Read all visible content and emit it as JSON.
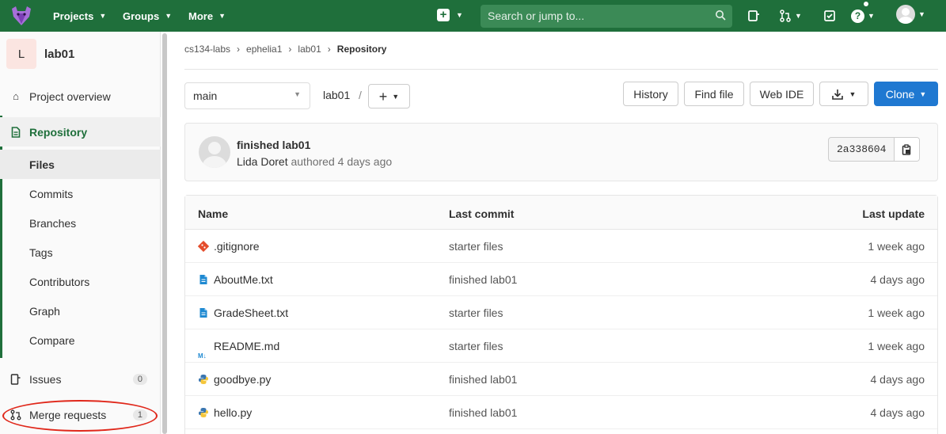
{
  "topnav": {
    "projects": "Projects",
    "groups": "Groups",
    "more": "More",
    "search_placeholder": "Search or jump to..."
  },
  "sidebar": {
    "project_initial": "L",
    "project_name": "lab01",
    "project_overview": "Project overview",
    "repository": "Repository",
    "sub_items": [
      "Files",
      "Commits",
      "Branches",
      "Tags",
      "Contributors",
      "Graph",
      "Compare"
    ],
    "issues": "Issues",
    "issues_count": "0",
    "merge_requests": "Merge requests",
    "merge_requests_count": "1"
  },
  "breadcrumb": {
    "items": [
      "cs134-labs",
      "ephelia1",
      "lab01"
    ],
    "current": "Repository"
  },
  "toolbar": {
    "branch": "main",
    "path": "lab01",
    "history": "History",
    "find_file": "Find file",
    "web_ide": "Web IDE",
    "clone": "Clone"
  },
  "commit": {
    "title": "finished lab01",
    "author": "Lida Doret",
    "meta": "authored 4 days ago",
    "sha": "2a338604"
  },
  "files": {
    "headers": {
      "name": "Name",
      "last_commit": "Last commit",
      "last_update": "Last update"
    },
    "rows": [
      {
        "name": ".gitignore",
        "commit": "starter files",
        "update": "1 week ago",
        "icon": "git-icon"
      },
      {
        "name": "AboutMe.txt",
        "commit": "finished lab01",
        "update": "4 days ago",
        "icon": "text-file-icon"
      },
      {
        "name": "GradeSheet.txt",
        "commit": "starter files",
        "update": "1 week ago",
        "icon": "text-file-icon"
      },
      {
        "name": "README.md",
        "commit": "starter files",
        "update": "1 week ago",
        "icon": "markdown-icon"
      },
      {
        "name": "goodbye.py",
        "commit": "finished lab01",
        "update": "4 days ago",
        "icon": "python-icon"
      },
      {
        "name": "hello.py",
        "commit": "finished lab01",
        "update": "4 days ago",
        "icon": "python-icon"
      }
    ]
  },
  "colors": {
    "nav_bg": "#1f6f3b",
    "accent": "#1f78d1",
    "highlight": "#e0281b"
  }
}
